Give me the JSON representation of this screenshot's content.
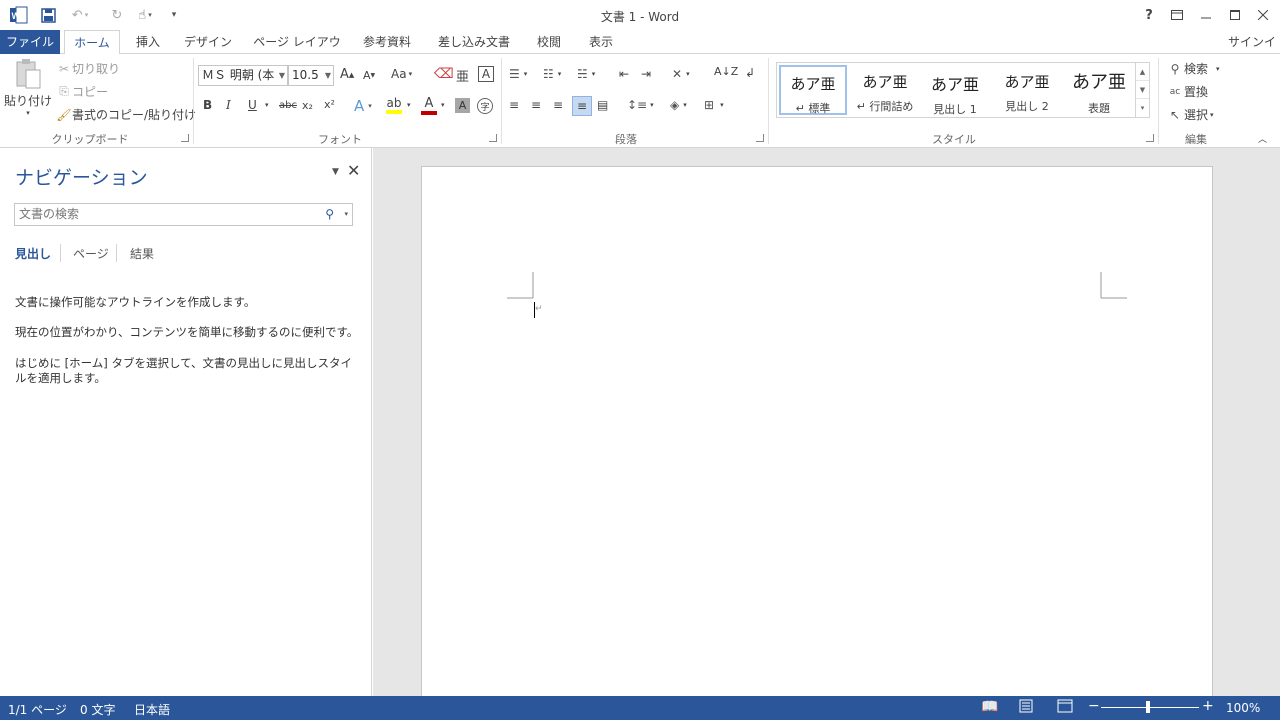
{
  "window": {
    "title": "文書 1 - Word"
  },
  "quick_access": {
    "app_icon": "word-icon",
    "save": "save-icon",
    "undo": "undo-icon",
    "redo": "redo-icon",
    "touch": "touch-mode-icon",
    "customize": "customize-icon"
  },
  "title_buttons": {
    "help": "?",
    "ribbon_display": "ribbon-display-icon",
    "minimize": "minimize-icon",
    "maximize": "maximize-icon",
    "close": "close-icon"
  },
  "tabs": [
    {
      "label": "ファイル"
    },
    {
      "label": "ホーム"
    },
    {
      "label": "挿入"
    },
    {
      "label": "デザイン"
    },
    {
      "label": "ページ レイアウト"
    },
    {
      "label": "参考資料"
    },
    {
      "label": "差し込み文書"
    },
    {
      "label": "校閲"
    },
    {
      "label": "表示"
    }
  ],
  "signin": "サインイン",
  "clipboard": {
    "paste_label": "貼り付け",
    "cut_label": "切り取り",
    "copy_label": "コピー",
    "format_painter_label": "書式のコピー/貼り付け",
    "group_label": "クリップボード"
  },
  "font": {
    "font_name": "ＭＳ 明朝 (本",
    "font_size": "10.5",
    "group_label": "フォント",
    "change_case": "Aa",
    "grow": "A",
    "shrink": "A",
    "bold": "B",
    "italic": "I",
    "underline": "U",
    "strike": "abc",
    "subscript": "x₂",
    "superscript": "x²",
    "highlight_color": "#ffff00",
    "font_color": "#c00000"
  },
  "paragraph": {
    "group_label": "段落"
  },
  "styles": {
    "group_label": "スタイル",
    "items": [
      {
        "preview": "あア亜",
        "name": "↵ 標準"
      },
      {
        "preview": "あア亜",
        "name": "↵ 行間詰め"
      },
      {
        "preview": "あア亜",
        "name": "見出し 1"
      },
      {
        "preview": "あア亜",
        "name": "見出し 2"
      },
      {
        "preview": "あア亜",
        "name": "表題"
      }
    ]
  },
  "editing": {
    "group_label": "編集",
    "find_label": "検索",
    "replace_label": "置換",
    "select_label": "選択"
  },
  "navigation": {
    "title": "ナビゲーション",
    "search_placeholder": "文書の検索",
    "tabs": [
      "見出し",
      "ページ",
      "結果"
    ],
    "text1": "文書に操作可能なアウトラインを作成します。",
    "text2": "現在の位置がわかり、コンテンツを簡単に移動するのに便利です。",
    "text3": "はじめに [ホーム] タブを選択して、文書の見出しに見出しスタイルを適用します。"
  },
  "status": {
    "page": "1/1 ページ",
    "words": "0 文字",
    "language": "日本語",
    "zoom": "100%"
  },
  "colors": {
    "accent": "#2b579a",
    "doc_background": "#e6e6e6"
  }
}
